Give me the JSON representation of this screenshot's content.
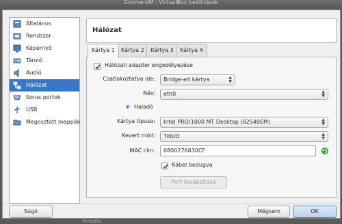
{
  "window": {
    "title": "Gnome-VM - VirtualBox beállítások"
  },
  "sidebar": {
    "items": [
      {
        "label": "Általános",
        "icon": "general-icon"
      },
      {
        "label": "Rendszer",
        "icon": "system-icon"
      },
      {
        "label": "Képernyő",
        "icon": "display-icon"
      },
      {
        "label": "Tároló",
        "icon": "storage-icon"
      },
      {
        "label": "Audió",
        "icon": "audio-icon"
      },
      {
        "label": "Hálózat",
        "icon": "network-icon",
        "selected": true
      },
      {
        "label": "Soros portok",
        "icon": "serial-port-icon"
      },
      {
        "label": "USB",
        "icon": "usb-icon"
      },
      {
        "label": "Megosztott mappák",
        "icon": "shared-folder-icon"
      }
    ]
  },
  "header": {
    "title": "Hálózat"
  },
  "tabs": [
    {
      "label": "Kártya 1",
      "active": true
    },
    {
      "label": "Kártya 2"
    },
    {
      "label": "Kártya 3"
    },
    {
      "label": "Kártya 4"
    }
  ],
  "adapter": {
    "enable_label": "Hálózati adapter engedélyezése",
    "enabled": true,
    "attached_label": "Csatlakoztatva ide:",
    "attached_value": "Bridge-elt kártya",
    "name_label": "Név:",
    "name_value": "eth0",
    "advanced_label": "Haladó",
    "type_label": "Kártya típusa:",
    "type_value": "Intel PRO/1000 MT Desktop (82540EM)",
    "promisc_label": "Kevert mód:",
    "promisc_value": "Tiltott",
    "mac_label": "MAC cím:",
    "mac_value": "0800276630CF",
    "cable_label": "Kábel bedugva",
    "cable_connected": true,
    "port_forward_label": "Port továbbítása"
  },
  "footer": {
    "help_label": "Súgó",
    "cancel_label": "Mégsem",
    "ok_label": "OK"
  },
  "background": {
    "text": "Virtuális"
  },
  "colors": {
    "selection": "#3a77c8",
    "accent": "#5b8ac4",
    "refresh": "#3aa335"
  }
}
